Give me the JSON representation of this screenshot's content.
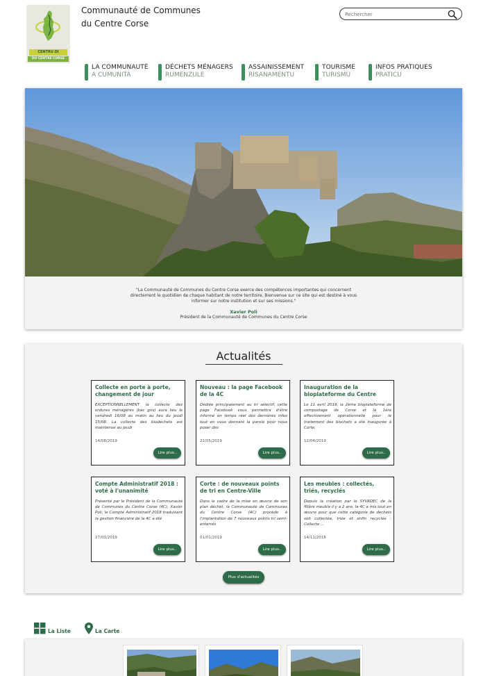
{
  "header": {
    "title_line1": "Communauté de Communes",
    "title_line2": "du Centre Corse",
    "logo": {
      "band1": "CENTRU DI CORSICA",
      "band2": "DU CENTRE CORSE"
    }
  },
  "search": {
    "placeholder": "Rechercher"
  },
  "nav": {
    "items": [
      {
        "fr": "LA COMMUNAUTÉ",
        "co": "A CUMUNITÀ"
      },
      {
        "fr": "DÉCHETS MÉNAGERS",
        "co": "RUMENZULE"
      },
      {
        "fr": "ASSAINISSEMENT",
        "co": "RISANAMENTU"
      },
      {
        "fr": "TOURISME",
        "co": "TURISMU"
      },
      {
        "fr": "INFOS PRATIQUES",
        "co": "PRATICU"
      }
    ]
  },
  "hero": {
    "quote": "\"La Communauté de Communes du Centre Corse exerce des compétences importantes qui concernent directement le quotidien de chaque habitant de notre territoire. Bienvenue sur ce site qui est destiné à vous informer sur notre institution et sur ses missions.\"",
    "author": "Xavier Poli",
    "role": "Président de la Communauté de Communes du Centre Corse"
  },
  "news": {
    "title": "Actualités",
    "read_more_label": "Lire plus..",
    "more_label": "Plus d'actualités",
    "items": [
      {
        "title": "Collecte en porte à porte, changement de jour",
        "excerpt": "EXCEPTIONNELLEMENT la collecte des ordures ménagères (bac gris) aura lieu le vendredi 16/08 au matin au lieu du jeudi 15/08. La collecte des biodéchets est maintenue au jeudi",
        "date": "14/08/2019"
      },
      {
        "title": "Nouveau : la page Facebook de la 4C",
        "excerpt": "Dédiée principalement au tri sélectif, cette page Facebook vous permettra d'être informé en temps réel des dernières infos tout en vous donnant la parole pour nous poser des",
        "date": "22/05/2019"
      },
      {
        "title": "Inauguration de la bioplateforme du Centre",
        "excerpt": "Le 11 avril 2019, la 2ème bioplateforme de compostage de Corse et la 1ère effectivement opérationnelle pour le traitement des biochets a été inaugurée à Corte.",
        "date": "12/04/2019"
      },
      {
        "title": "Compte Administratif 2018 : voté à l'unanimité",
        "excerpt": "Présenté par le Président de la Communauté de Communes du Centre Corse (4C), Xavier Poli, le Compte Administratif 2018 traduisant la gestion financière de la 4C a été",
        "date": "27/03/2019"
      },
      {
        "title": "Corte : de nouveaux points de tri en Centre-Ville",
        "excerpt": "Dans le cadre de la mise en œuvre de son plan déchet, la Communauté de Communes du Centre Corse (4C) procède à l'implantation de 7 nouveaux points tri semi-enterrés",
        "date": "01/01/2019"
      },
      {
        "title": "Les meubles : collectés, triés, recyclés",
        "excerpt": "Depuis la création par le SYVADEC de la filière meuble il y a 2 ans, la 4C a mis tout en œuvre pour que cette catégorie de déchets soit collectée, triée et enfin recyclée : Collecte ...",
        "date": "14/11/2018"
      }
    ]
  },
  "views": {
    "list_label": "La Liste",
    "map_label": "La Carte"
  },
  "colors": {
    "accent_green": "#2e6b48",
    "nav_bar_green": "#3f8f5e",
    "panel_bg": "#f3f3f3"
  }
}
